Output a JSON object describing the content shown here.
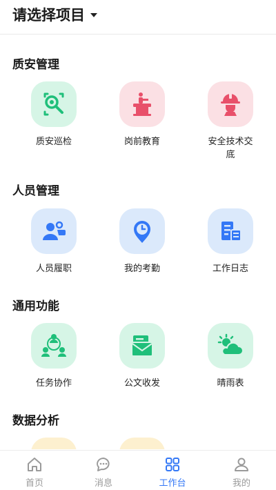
{
  "header": {
    "title": "请选择项目"
  },
  "sections": [
    {
      "title": "质安管理",
      "items": [
        {
          "label": "质安巡检",
          "icon": "inspection-search-icon",
          "color": "#1fbf7a"
        },
        {
          "label": "岗前教育",
          "icon": "podium-icon",
          "color": "#e8506a"
        },
        {
          "label": "安全技术交底",
          "icon": "hardhat-worker-icon",
          "color": "#e8506a"
        }
      ]
    },
    {
      "title": "人员管理",
      "items": [
        {
          "label": "人员履职",
          "icon": "person-duty-icon",
          "color": "#3478f6"
        },
        {
          "label": "我的考勤",
          "icon": "clock-pin-icon",
          "color": "#3478f6"
        },
        {
          "label": "工作日志",
          "icon": "work-log-icon",
          "color": "#3478f6"
        }
      ]
    },
    {
      "title": "通用功能",
      "items": [
        {
          "label": "任务协作",
          "icon": "team-collaboration-icon",
          "color": "#1fbf7a"
        },
        {
          "label": "公文收发",
          "icon": "document-envelope-icon",
          "color": "#1fbf7a"
        },
        {
          "label": "晴雨表",
          "icon": "sun-cloud-icon",
          "color": "#1fbf7a"
        }
      ]
    },
    {
      "title": "数据分析"
    }
  ],
  "tabbar": {
    "items": [
      {
        "label": "首页",
        "icon": "home-icon",
        "active": false
      },
      {
        "label": "消息",
        "icon": "chat-bubble-icon",
        "active": false
      },
      {
        "label": "工作台",
        "icon": "grid-icon",
        "active": true
      },
      {
        "label": "我的",
        "icon": "user-icon",
        "active": false
      }
    ]
  }
}
